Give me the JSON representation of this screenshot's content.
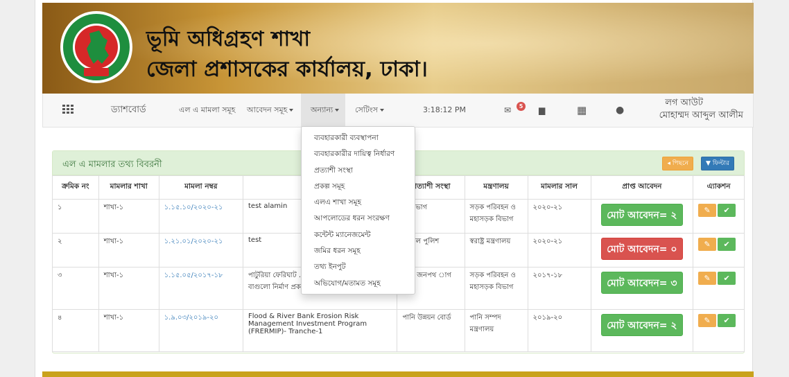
{
  "header": {
    "title": "ভূমি অধিগ্রহণ শাখা",
    "subtitle": "জেলা প্রশাসকের কার্যালয়, ঢাকা।",
    "seal_text": "গণপ্রজাতন্ত্রী বাংলাদেশ সরকার"
  },
  "nav": {
    "dashboard": "ড্যাশবোর্ড",
    "la_cases": "এল এ মামলা সমূহ",
    "applications": "আবেদন সমূহ",
    "others": "অন্যান্য",
    "settings": "সেটিংস",
    "clock": "3:18:12 PM",
    "mail_count": "5",
    "logout": "লগ আউট",
    "user_name": "মোহাম্মদ আব্দুল আলীম"
  },
  "dropdown": [
    "ব্যবহারকারী ব্যবস্থাপনা",
    "ব্যবহারকারীর দায়িত্ব নির্ধারণ",
    "প্রত্যাশী সংস্থা",
    "প্রকল্প সমূহ",
    "এলএ শাখা সমূহ",
    "আপলোডের ধরন সংরক্ষণ",
    "কন্টেন্ট ম্যানেজমেন্ট",
    "জমির ধরন সমূহ",
    "তথ্য ইনপুট",
    "অভিযোগ/মতামত সমূহ"
  ],
  "panel": {
    "title": "এল এ মামলার তথ্য বিবরনী",
    "back_label": "পিছনে",
    "filter_label": "ফিল্টার"
  },
  "table": {
    "headers": [
      "ক্রমিক নং",
      "মামলার শাখা",
      "মামলা নম্বর",
      "",
      "প্রত্যাশী সংস্থা",
      "মন্ত্রণালয়",
      "মামলার সাল",
      "প্রাপ্ত আবেদন",
      "এ্যাকশন"
    ],
    "rows": [
      {
        "sl": "১",
        "branch": "শাখা-১",
        "case_no": "১.১৫.১০/২০২০-২১",
        "project": "test alamin",
        "agency": "ড় বিভাগ",
        "ministry": "সড়ক পরিবহন ও মহাসড়ক বিভাগ",
        "year": "২০২০-২১",
        "applications": "মোট আবেদন= ২",
        "status": "green"
      },
      {
        "sl": "২",
        "branch": "শাখা-১",
        "case_no": "১.২১.০১/২০২০-২১",
        "project": "test",
        "agency": "স্ট্রিয়াল পুলিশ",
        "ministry": "স্বরাষ্ট্র মন্ত্রণালয়",
        "year": "২০২০-২১",
        "applications": "মোট আবেদন= ০",
        "status": "red"
      },
      {
        "sl": "৩",
        "branch": "শাখা-১",
        "case_no": "১.১৫.০৫/২০১৭-১৮",
        "project": "পাটুরিয়া ফেরিঘাট ... উপজেলাধীন ধুতুরা ... বাগুলো নির্মাণ প্রকল্প,",
        "agency": "ক ও জনপথ াগ",
        "ministry": "সড়ক পরিবহন ও মহাসড়ক বিভাগ",
        "year": "২০১৭-১৮",
        "applications": "মোট আবেদন= ৩",
        "status": "green"
      },
      {
        "sl": "৪",
        "branch": "শাখা-১",
        "case_no": "১.৯.০৩/২০১৯-২০",
        "project": "Flood & River Bank Erosion Risk Management Investment Program (FRERMIP)- Tranche-1",
        "agency": "পানি উন্নয়ন বোর্ড",
        "ministry": "পানি সম্পদ মন্ত্রণালয়",
        "year": "২০১৯-২০",
        "applications": "মোট আবেদন= ২",
        "status": "green"
      }
    ]
  }
}
